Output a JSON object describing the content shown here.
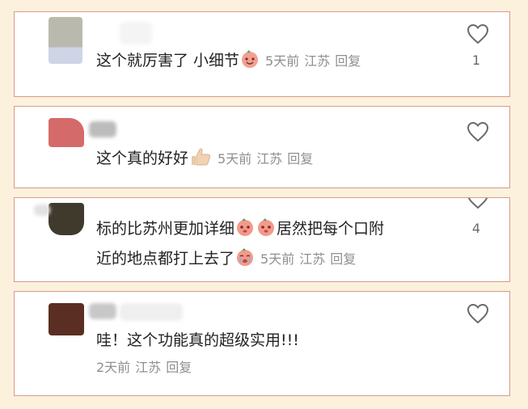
{
  "comments": [
    {
      "text_before": "这个就厉害了 小细节",
      "emoji": "smiling-peach-emoji",
      "time": "5天前",
      "location": "江苏",
      "reply": "回复",
      "likes": "1"
    },
    {
      "text_before": "这个真的好好",
      "emoji": "thumbs-up-emoji",
      "time": "5天前",
      "location": "江苏",
      "reply": "回复",
      "likes": ""
    },
    {
      "text_line1_a": "标的比苏州更加详细",
      "text_line1_b": "居然把每个口附",
      "text_line2": "近的地点都打上去了",
      "emojis": [
        "blushing-peach-emoji",
        "blushing-peach-emoji",
        "crying-peach-emoji"
      ],
      "time": "5天前",
      "location": "江苏",
      "reply": "回复",
      "likes": "4"
    },
    {
      "text": "哇！这个功能真的超级实用!!!",
      "time": "2天前",
      "location": "江苏",
      "reply": "回复",
      "likes": ""
    }
  ],
  "icons": {
    "like": "heart-outline-icon"
  },
  "colors": {
    "background": "#fbf1dd",
    "card_border": "#d99a8c",
    "meta_text": "#8f8f8f"
  }
}
